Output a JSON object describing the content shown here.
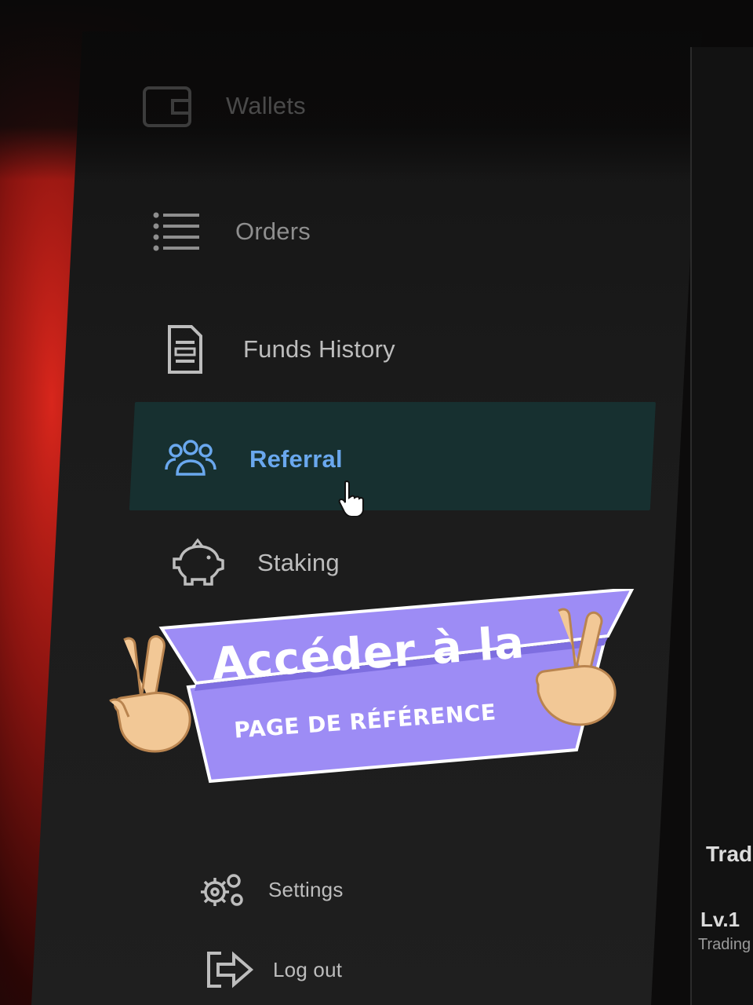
{
  "nav": {
    "wallets": "Wallets",
    "orders": "Orders",
    "funds_history": "Funds History",
    "referral": "Referral",
    "staking": "Staking",
    "settings": "Settings",
    "logout": "Log out"
  },
  "icons": {
    "wallets": "wallet-icon",
    "orders": "list-icon",
    "funds_history": "document-icon",
    "referral": "users-icon",
    "staking": "piggy-bank-icon",
    "settings": "gears-icon",
    "logout": "logout-icon"
  },
  "banner": {
    "title": "Accéder à la",
    "subtitle": "PAGE DE RÉFÉRENCE",
    "color": "#9d8cf5"
  },
  "right_panel": {
    "heading": "Trad",
    "level": "Lv.1",
    "level_caption": "Trading"
  },
  "colors": {
    "active_accent": "#6aa8ee",
    "active_background": "#173030",
    "text": "#bdbdbd"
  }
}
